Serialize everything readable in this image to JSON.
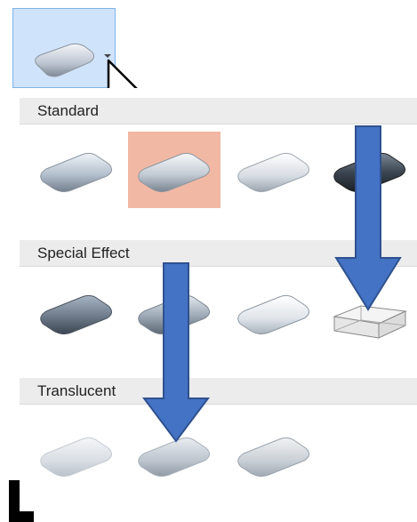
{
  "trigger": {
    "preview_icon": "rounded-shape-preview",
    "caret_icon": "chevron-down-icon",
    "cursor_icon": "mouse-pointer-icon"
  },
  "sections": [
    {
      "id": "standard",
      "label": "Standard"
    },
    {
      "id": "special-effect",
      "label": "Special Effect"
    },
    {
      "id": "translucent",
      "label": "Translucent"
    }
  ],
  "colors": {
    "selected_tile_bg": "#f1b8a4",
    "hover_trigger_bg": "#cfe3fa",
    "arrow_fill": "#4472c4",
    "arrow_stroke": "#2f528f"
  }
}
